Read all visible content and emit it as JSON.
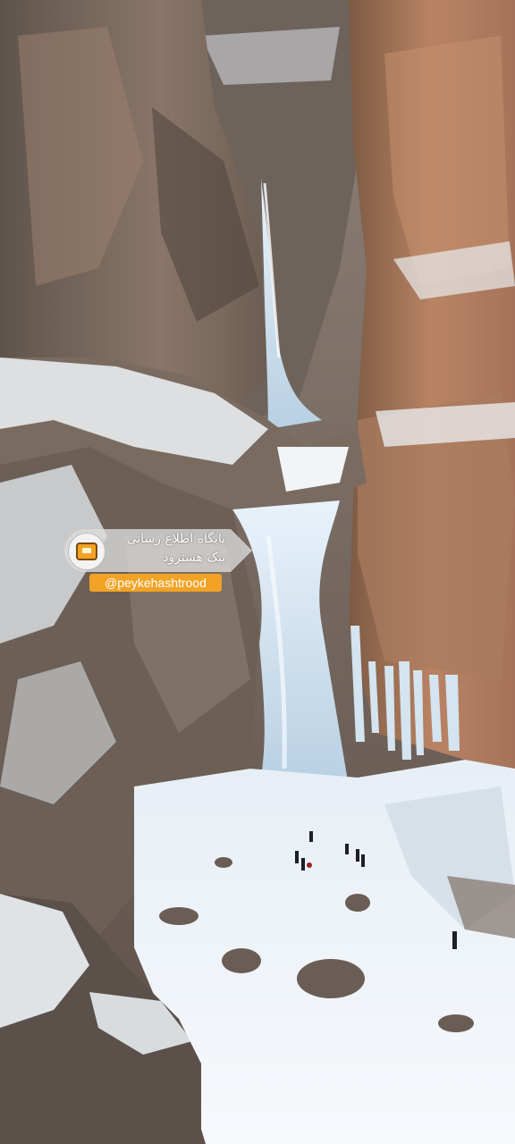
{
  "scene": {
    "description_icon": "frozen-waterfall-photo",
    "colors": {
      "rock_warm": "#b07a58",
      "rock_gray": "#7a6e64",
      "ice": "#dbe9f3",
      "snow": "#f2f6fa",
      "brand_orange": "#f2a325"
    }
  },
  "watermark": {
    "title_line1": "پایگاه اطلاع رسانی",
    "title_line2": "پیک هشترود",
    "handle": "@peykehashtrood",
    "logo_icon": "tv-logo-icon"
  }
}
